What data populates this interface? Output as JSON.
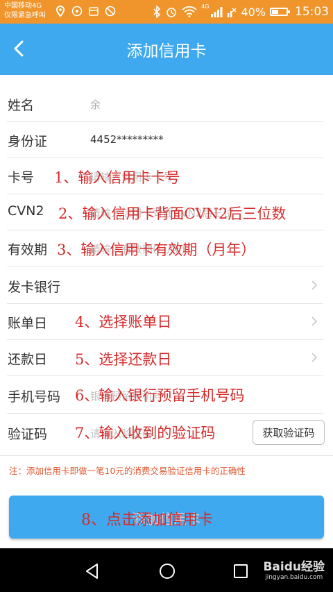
{
  "status_bar": {
    "carrier_line1": "中国移动4G",
    "carrier_line2": "仅限紧急呼叫",
    "network": "4G",
    "battery": "40%",
    "battery_level": 0.4,
    "time": "15:03"
  },
  "header": {
    "title": "添加信用卡",
    "back_icon": "back-arrow-icon"
  },
  "form": {
    "name_label": "姓名",
    "name_value": "余",
    "id_label": "身份证",
    "id_value": "4452*********",
    "card_label": "卡号",
    "card_placeholder": "请输入信用卡卡号",
    "cvn_label": "CVN2",
    "cvn_placeholder": "请输入信用卡背面CVN2后三位",
    "expiry_label": "有效期",
    "expiry_placeholder": "请输入有效期(月/年)",
    "bank_label": "发卡银行",
    "bill_label": "账单日",
    "repay_label": "还款日",
    "phone_label": "手机号码",
    "phone_placeholder": "银行预留手机号",
    "code_label": "验证码",
    "code_placeholder": "请输入验证码",
    "code_button": "获取验证码"
  },
  "annotations": {
    "a1": "1、输入信用卡卡号",
    "a2": "2、输入信用卡背面CVN2后三位数",
    "a3": "3、输入信用卡有效期（月年）",
    "a4": "4、选择账单日",
    "a5": "5、选择还款日",
    "a6": "6、输入银行预留手机号码",
    "a7": "7、输入收到的验证码",
    "a8": "8、点击添加信用卡"
  },
  "note": "注：添加信用卡即做一笔10元的消费交易验证信用卡的正确性",
  "submit_label": "添加信用卡",
  "watermark": {
    "main": "Baidu经验",
    "sub": "jingyan.baidu.com"
  },
  "colors": {
    "status_bar": "#f0952c",
    "header": "#3ea9ee",
    "annotation": "#d62b2b",
    "note": "#e0582f"
  }
}
